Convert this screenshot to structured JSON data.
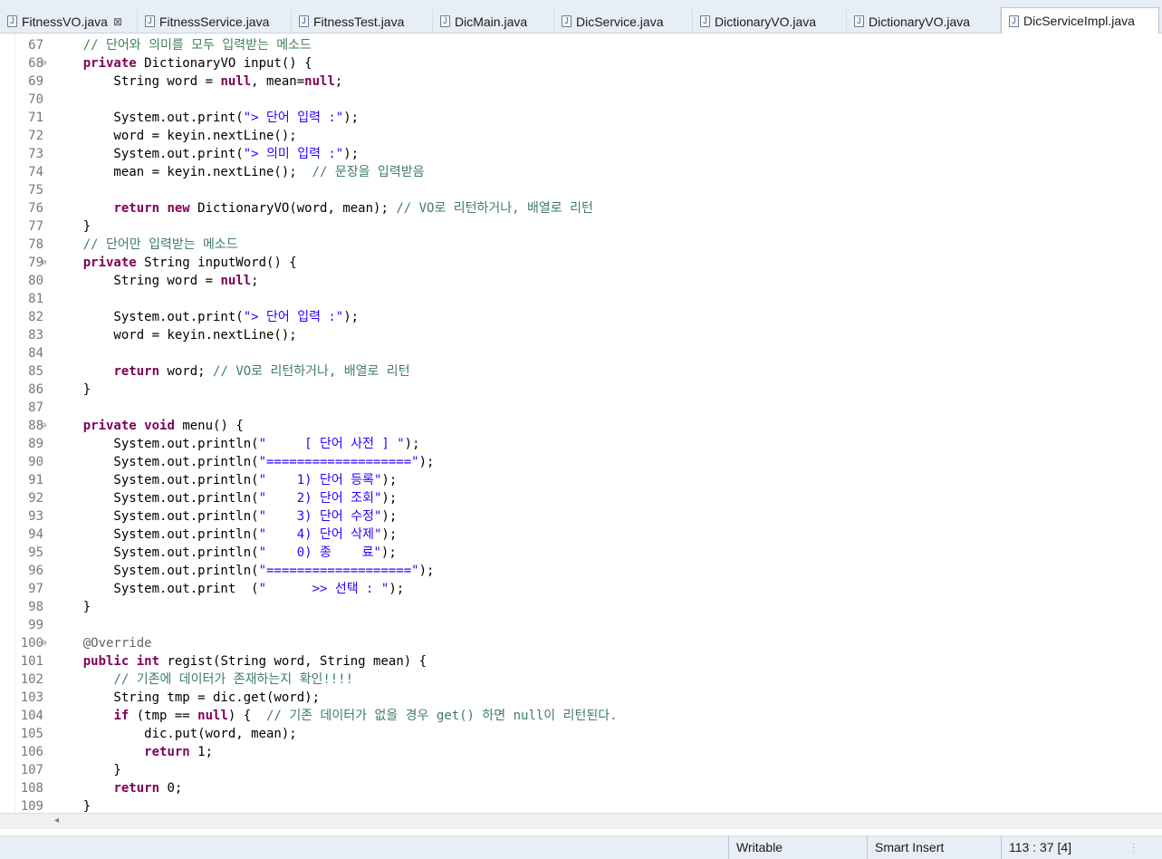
{
  "tabs": [
    {
      "label": "FitnessVO.java",
      "active": false,
      "closable": true
    },
    {
      "label": "FitnessService.java",
      "active": false
    },
    {
      "label": "FitnessTest.java",
      "active": false
    },
    {
      "label": "DicMain.java",
      "active": false
    },
    {
      "label": "DicService.java",
      "active": false
    },
    {
      "label": "DictionaryVO.java",
      "active": false
    },
    {
      "label": "DictionaryVO.java",
      "active": false
    },
    {
      "label": "DicServiceImpl.java",
      "active": true
    }
  ],
  "tab_close_glyph": "⊠",
  "lines": [
    {
      "n": "67",
      "fold": false,
      "segs": [
        [
          "    ",
          ""
        ],
        [
          "// 단어와 의미를 모두 입력받는 메소드",
          "cm"
        ]
      ]
    },
    {
      "n": "68",
      "fold": true,
      "segs": [
        [
          "    ",
          ""
        ],
        [
          "private",
          "kw"
        ],
        [
          " DictionaryVO input() {",
          ""
        ]
      ]
    },
    {
      "n": "69",
      "fold": false,
      "segs": [
        [
          "        String word = ",
          ""
        ],
        [
          "null",
          "kw"
        ],
        [
          ", mean=",
          ""
        ],
        [
          "null",
          "kw"
        ],
        [
          ";",
          ""
        ]
      ]
    },
    {
      "n": "70",
      "fold": false,
      "segs": []
    },
    {
      "n": "71",
      "fold": false,
      "segs": [
        [
          "        System.out.print(",
          ""
        ],
        [
          "\"> 단어 입력 :\"",
          "str"
        ],
        [
          ");",
          ""
        ]
      ]
    },
    {
      "n": "72",
      "fold": false,
      "segs": [
        [
          "        word = keyin.nextLine();",
          ""
        ]
      ]
    },
    {
      "n": "73",
      "fold": false,
      "segs": [
        [
          "        System.out.print(",
          ""
        ],
        [
          "\"> 의미 입력 :\"",
          "str"
        ],
        [
          ");",
          ""
        ]
      ]
    },
    {
      "n": "74",
      "fold": false,
      "segs": [
        [
          "        mean = keyin.nextLine();  ",
          ""
        ],
        [
          "// 문장을 입력받음",
          "cm"
        ]
      ]
    },
    {
      "n": "75",
      "fold": false,
      "segs": []
    },
    {
      "n": "76",
      "fold": false,
      "segs": [
        [
          "        ",
          ""
        ],
        [
          "return",
          "kw"
        ],
        [
          " ",
          ""
        ],
        [
          "new",
          "kw"
        ],
        [
          " DictionaryVO(word, mean); ",
          ""
        ],
        [
          "// VO로 리턴하거나, 배열로 리턴",
          "cm"
        ]
      ]
    },
    {
      "n": "77",
      "fold": false,
      "segs": [
        [
          "    }",
          ""
        ]
      ]
    },
    {
      "n": "78",
      "fold": false,
      "segs": [
        [
          "    ",
          ""
        ],
        [
          "// 단어만 입력받는 메소드",
          "cm"
        ]
      ]
    },
    {
      "n": "79",
      "fold": true,
      "segs": [
        [
          "    ",
          ""
        ],
        [
          "private",
          "kw"
        ],
        [
          " String inputWord() {",
          ""
        ]
      ]
    },
    {
      "n": "80",
      "fold": false,
      "segs": [
        [
          "        String word = ",
          ""
        ],
        [
          "null",
          "kw"
        ],
        [
          ";",
          ""
        ]
      ]
    },
    {
      "n": "81",
      "fold": false,
      "segs": []
    },
    {
      "n": "82",
      "fold": false,
      "segs": [
        [
          "        System.out.print(",
          ""
        ],
        [
          "\"> 단어 입력 :\"",
          "str"
        ],
        [
          ");",
          ""
        ]
      ]
    },
    {
      "n": "83",
      "fold": false,
      "segs": [
        [
          "        word = keyin.nextLine();",
          ""
        ]
      ]
    },
    {
      "n": "84",
      "fold": false,
      "segs": []
    },
    {
      "n": "85",
      "fold": false,
      "segs": [
        [
          "        ",
          ""
        ],
        [
          "return",
          "kw"
        ],
        [
          " word; ",
          ""
        ],
        [
          "// VO로 리턴하거나, 배열로 리턴",
          "cm"
        ]
      ]
    },
    {
      "n": "86",
      "fold": false,
      "segs": [
        [
          "    }",
          ""
        ]
      ]
    },
    {
      "n": "87",
      "fold": false,
      "segs": []
    },
    {
      "n": "88",
      "fold": true,
      "segs": [
        [
          "    ",
          ""
        ],
        [
          "private",
          "kw"
        ],
        [
          " ",
          ""
        ],
        [
          "void",
          "kw"
        ],
        [
          " menu() {",
          ""
        ]
      ]
    },
    {
      "n": "89",
      "fold": false,
      "segs": [
        [
          "        System.out.println(",
          ""
        ],
        [
          "\"     [ 단어 사전 ] \"",
          "str"
        ],
        [
          ");",
          ""
        ]
      ]
    },
    {
      "n": "90",
      "fold": false,
      "segs": [
        [
          "        System.out.println(",
          ""
        ],
        [
          "\"===================\"",
          "str"
        ],
        [
          ");",
          ""
        ]
      ]
    },
    {
      "n": "91",
      "fold": false,
      "segs": [
        [
          "        System.out.println(",
          ""
        ],
        [
          "\"    1) 단어 등록\"",
          "str"
        ],
        [
          ");",
          ""
        ]
      ]
    },
    {
      "n": "92",
      "fold": false,
      "segs": [
        [
          "        System.out.println(",
          ""
        ],
        [
          "\"    2) 단어 조회\"",
          "str"
        ],
        [
          ");",
          ""
        ]
      ]
    },
    {
      "n": "93",
      "fold": false,
      "segs": [
        [
          "        System.out.println(",
          ""
        ],
        [
          "\"    3) 단어 수정\"",
          "str"
        ],
        [
          ");",
          ""
        ]
      ]
    },
    {
      "n": "94",
      "fold": false,
      "segs": [
        [
          "        System.out.println(",
          ""
        ],
        [
          "\"    4) 단어 삭제\"",
          "str"
        ],
        [
          ");",
          ""
        ]
      ]
    },
    {
      "n": "95",
      "fold": false,
      "segs": [
        [
          "        System.out.println(",
          ""
        ],
        [
          "\"    0) 종    료\"",
          "str"
        ],
        [
          ");",
          ""
        ]
      ]
    },
    {
      "n": "96",
      "fold": false,
      "segs": [
        [
          "        System.out.println(",
          ""
        ],
        [
          "\"===================\"",
          "str"
        ],
        [
          ");",
          ""
        ]
      ]
    },
    {
      "n": "97",
      "fold": false,
      "segs": [
        [
          "        System.out.print  (",
          ""
        ],
        [
          "\"      >> 선택 : \"",
          "str"
        ],
        [
          ");",
          ""
        ]
      ]
    },
    {
      "n": "98",
      "fold": false,
      "segs": [
        [
          "    }",
          ""
        ]
      ]
    },
    {
      "n": "99",
      "fold": false,
      "segs": []
    },
    {
      "n": "100",
      "fold": true,
      "segs": [
        [
          "    ",
          ""
        ],
        [
          "@Override",
          "ann"
        ]
      ]
    },
    {
      "n": "101",
      "fold": false,
      "segs": [
        [
          "    ",
          ""
        ],
        [
          "public",
          "kw"
        ],
        [
          " ",
          ""
        ],
        [
          "int",
          "kw"
        ],
        [
          " regist(String word, String mean) {",
          ""
        ]
      ]
    },
    {
      "n": "102",
      "fold": false,
      "segs": [
        [
          "        ",
          ""
        ],
        [
          "// 기존에 데이터가 존재하는지 확인!!!!",
          "cm"
        ]
      ]
    },
    {
      "n": "103",
      "fold": false,
      "segs": [
        [
          "        String tmp = dic.get(word);",
          ""
        ]
      ]
    },
    {
      "n": "104",
      "fold": false,
      "segs": [
        [
          "        ",
          ""
        ],
        [
          "if",
          "kw"
        ],
        [
          " (tmp == ",
          ""
        ],
        [
          "null",
          "kw"
        ],
        [
          ") {  ",
          ""
        ],
        [
          "// 기존 데이터가 없을 경우 get() 하면 null이 리턴된다.",
          "cm"
        ]
      ]
    },
    {
      "n": "105",
      "fold": false,
      "segs": [
        [
          "            dic.put(word, mean);",
          ""
        ]
      ]
    },
    {
      "n": "106",
      "fold": false,
      "segs": [
        [
          "            ",
          ""
        ],
        [
          "return",
          "kw"
        ],
        [
          " 1;",
          ""
        ]
      ]
    },
    {
      "n": "107",
      "fold": false,
      "segs": [
        [
          "        }",
          ""
        ]
      ]
    },
    {
      "n": "108",
      "fold": false,
      "segs": [
        [
          "        ",
          ""
        ],
        [
          "return",
          "kw"
        ],
        [
          " 0;",
          ""
        ]
      ]
    },
    {
      "n": "109",
      "fold": false,
      "segs": [
        [
          "    }",
          ""
        ]
      ]
    }
  ],
  "status": {
    "writable": "Writable",
    "insert_mode": "Smart Insert",
    "position": "113 : 37 [4]"
  }
}
